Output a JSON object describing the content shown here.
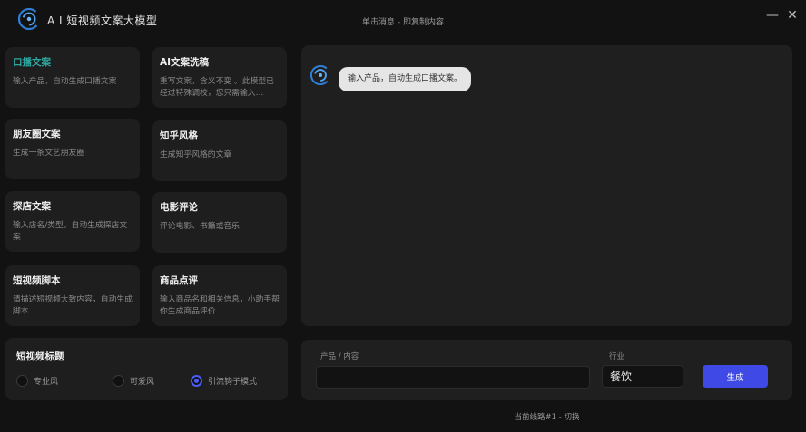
{
  "app": {
    "title": "A I 短视频文案大模型",
    "hint": "单击消息 - 即复制内容",
    "minimize_glyph": "—",
    "close_glyph": "✕",
    "logo_icon": "swirl-logo-icon",
    "accent_color": "#2fa7a0",
    "primary_color": "#3f49e6"
  },
  "cards": [
    {
      "title": "口播文案",
      "desc": "输入产品，自动生成口播文案",
      "active": true
    },
    {
      "title": "AI文案洗稿",
      "desc": "重写文案，含义不变 。此模型已经过特殊调校，您只需输入…"
    },
    {
      "title": "朋友圈文案",
      "desc": "生成一条文艺朋友圈"
    },
    {
      "title": "知乎风格",
      "desc": "生成知乎风格的文章"
    },
    {
      "title": "探店文案",
      "desc": "输入店名/类型，自动生成探店文案"
    },
    {
      "title": "电影评论",
      "desc": "评论电影、书籍或音乐"
    },
    {
      "title": "短视频脚本",
      "desc": "请描述短视频大致内容，自动生成脚本"
    },
    {
      "title": "商品点评",
      "desc": "输入商品名和相关信息，小助手帮你生成商品评价"
    }
  ],
  "chat": {
    "messages": [
      {
        "from": "bot",
        "text": "输入产品，自动生成口播文案。"
      }
    ]
  },
  "title_panel": {
    "title": "短视频标题",
    "options": [
      {
        "label": "专业风",
        "checked": false
      },
      {
        "label": "可爱风",
        "checked": false
      },
      {
        "label": "引流钩子模式",
        "checked": true
      }
    ]
  },
  "form": {
    "product_label": "产品 / 内容",
    "product_value": "",
    "industry_label": "行业",
    "industry_value": "餐饮",
    "generate_label": "生成"
  },
  "footer": {
    "text": "当前线路#1 - 切换"
  }
}
